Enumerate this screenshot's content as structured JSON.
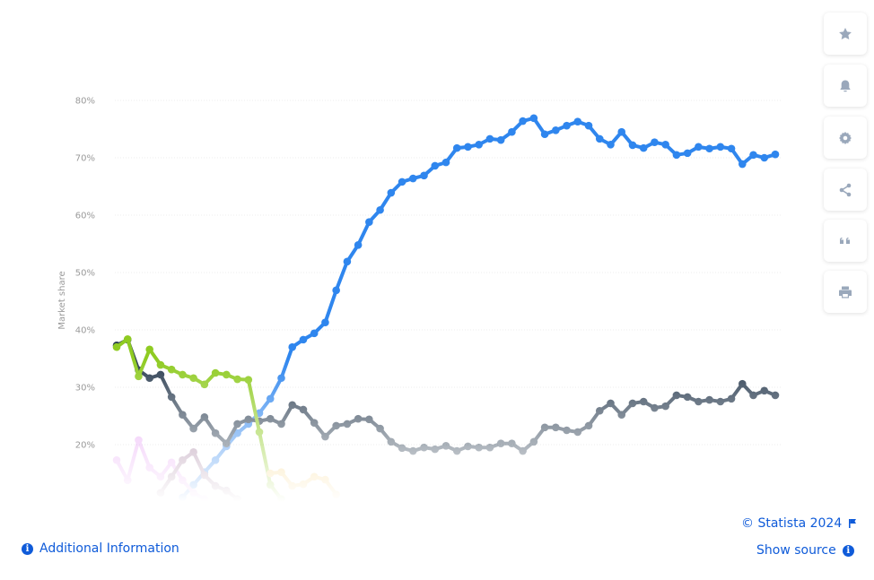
{
  "chart_data": {
    "type": "line",
    "title": "",
    "xlabel": "",
    "ylabel": "Market share",
    "ylim": [
      10,
      80
    ],
    "yticks": [
      "20%",
      "30%",
      "40%",
      "50%",
      "60%",
      "70%",
      "80%"
    ],
    "ytick_values": [
      20,
      30,
      40,
      50,
      60,
      70,
      80
    ],
    "grid": true,
    "series": [
      {
        "color": "#2f86ee",
        "values": [
          null,
          null,
          null,
          null,
          null,
          null,
          10.8,
          13.0,
          15.2,
          17.3,
          19.7,
          22.0,
          23.6,
          25.5,
          28.0,
          31.6,
          37.0,
          38.3,
          39.4,
          41.3,
          46.9,
          51.9,
          54.8,
          58.8,
          60.9,
          63.9,
          65.8,
          66.4,
          66.9,
          68.6,
          69.2,
          71.7,
          71.9,
          72.3,
          73.3,
          73.1,
          74.5,
          76.4,
          76.9,
          74.1,
          74.8,
          75.6,
          76.3,
          75.6,
          73.3,
          72.3,
          74.5,
          72.2,
          71.7,
          72.7,
          72.3,
          70.5,
          70.8,
          71.9,
          71.6,
          71.9,
          71.6,
          68.9,
          70.5,
          70.0,
          70.6
        ]
      },
      {
        "color": "#2c3e52",
        "values": [
          37.3,
          38.3,
          33.0,
          31.6,
          32.2,
          28.3,
          25.2,
          22.8,
          24.8,
          22.0,
          20.2,
          23.6,
          24.4,
          24.1,
          24.5,
          23.6,
          26.9,
          26.1,
          23.8,
          21.4,
          23.3,
          23.6,
          24.5,
          24.4,
          22.8,
          20.5,
          19.4,
          18.9,
          19.5,
          19.2,
          19.8,
          18.9,
          19.7,
          19.5,
          19.5,
          20.2,
          20.2,
          18.9,
          20.5,
          23.0,
          23.0,
          22.5,
          22.2,
          23.3,
          25.9,
          27.2,
          25.2,
          27.2,
          27.5,
          26.4,
          26.7,
          28.6,
          28.3,
          27.5,
          27.8,
          27.5,
          28.0,
          30.6,
          28.6,
          29.4,
          28.6
        ]
      },
      {
        "color": "#8fcb22",
        "values": [
          37.0,
          38.4,
          31.9,
          36.6,
          33.9,
          33.1,
          32.2,
          31.6,
          30.5,
          32.5,
          32.2,
          31.4,
          31.3,
          22.2,
          13.0,
          10.5
        ]
      },
      {
        "color": "#f7cf72",
        "values": [
          null,
          null,
          null,
          null,
          null,
          null,
          null,
          null,
          null,
          null,
          null,
          null,
          null,
          null,
          15.0,
          15.2,
          12.8,
          13.1,
          14.4,
          13.9,
          11.3
        ]
      },
      {
        "color": "#e9acf5",
        "values": [
          17.3,
          13.8,
          20.8,
          16.0,
          14.4,
          16.9,
          13.8,
          11.6,
          10.5
        ]
      },
      {
        "color": "#a5809f",
        "values": [
          null,
          null,
          null,
          null,
          11.6,
          14.4,
          17.3,
          18.7,
          14.7,
          12.8,
          12.0,
          10.5
        ]
      }
    ]
  },
  "sidebar": {
    "buttons": [
      {
        "icon": "star-icon",
        "name": "favorite-button"
      },
      {
        "icon": "bell-icon",
        "name": "notification-button"
      },
      {
        "icon": "gear-icon",
        "name": "settings-button"
      },
      {
        "icon": "share-icon",
        "name": "share-button"
      },
      {
        "icon": "quote-icon",
        "name": "cite-button"
      },
      {
        "icon": "print-icon",
        "name": "print-button"
      }
    ]
  },
  "footer": {
    "copyright": "© Statista 2024",
    "additional_info": "Additional Information",
    "show_source": "Show source",
    "link_color": "#0f5bd9"
  }
}
